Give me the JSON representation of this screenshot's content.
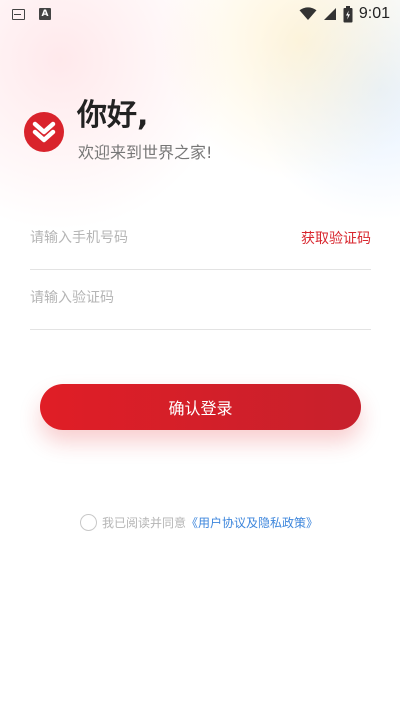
{
  "status_bar": {
    "time": "9:01",
    "icons": [
      "image-icon",
      "a-icon",
      "wifi-icon",
      "signal-icon",
      "battery-charging-icon"
    ]
  },
  "colors": {
    "accent": "#e01e26",
    "link": "#3d86dc",
    "placeholder": "#b5b5b5"
  },
  "header": {
    "greeting": "你好,",
    "welcome": "欢迎来到世界之家!"
  },
  "form": {
    "phone_placeholder": "请输入手机号码",
    "get_code_label": "获取验证码",
    "code_placeholder": "请输入验证码",
    "login_label": "确认登录"
  },
  "agreement": {
    "text": "我已阅读并同意",
    "link": "《用户协议及隐私政策》"
  }
}
